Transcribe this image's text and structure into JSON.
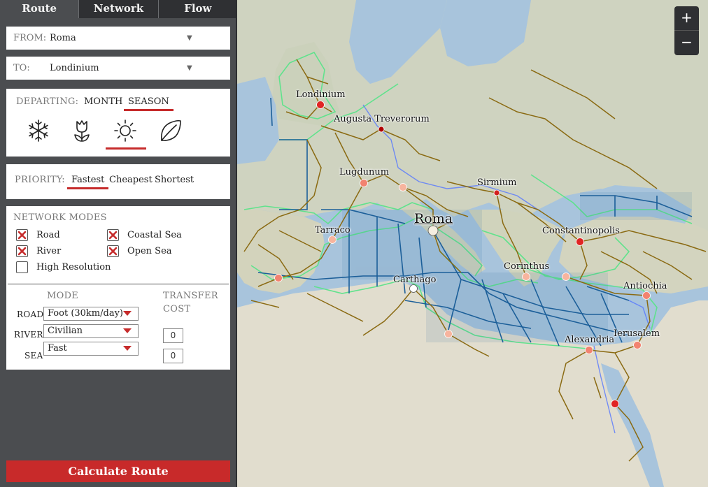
{
  "tabs": [
    "Route",
    "Network",
    "Flow"
  ],
  "from": {
    "label": "FROM:",
    "value": "Roma"
  },
  "to": {
    "label": "TO:",
    "value": "Londinium"
  },
  "departing": {
    "label": "DEPARTING:",
    "options": [
      "MONTH",
      "SEASON"
    ],
    "active": "SEASON",
    "seasons": [
      "winter-snowflake-icon",
      "spring-tulip-icon",
      "summer-sun-icon",
      "autumn-leaf-icon"
    ],
    "active_season": "summer"
  },
  "priority": {
    "label": "PRIORITY:",
    "options": [
      "Fastest",
      "Cheapest",
      "Shortest"
    ],
    "active": "Fastest"
  },
  "network_modes": {
    "title": "NETWORK MODES",
    "items": [
      {
        "label": "Road",
        "checked": true
      },
      {
        "label": "Coastal Sea",
        "checked": true
      },
      {
        "label": "River",
        "checked": true
      },
      {
        "label": "Open Sea",
        "checked": true
      },
      {
        "label": "High Resolution",
        "checked": false
      }
    ]
  },
  "modes": {
    "mode_header": "MODE",
    "transfer_header": "TRANSFER",
    "cost_header": "COST",
    "rows": [
      {
        "label": "ROAD",
        "value": "Foot (30km/day)"
      },
      {
        "label": "RIVER",
        "value": "Civilian"
      },
      {
        "label": "SEA",
        "value": "Fast"
      }
    ],
    "costs": [
      "0",
      "0"
    ]
  },
  "calculate_label": "Calculate Route",
  "zoom": {
    "in": "+",
    "out": "−"
  },
  "cities": [
    "Londinium",
    "Augusta Treverorum",
    "Lugdunum",
    "Sirmium",
    "Roma",
    "Tarraco",
    "Constantinopolis",
    "Corinthus",
    "Carthago",
    "Antiochia",
    "Alexandria",
    "Ierusalem"
  ],
  "colors": {
    "accent": "#c62b2b",
    "sea": "#a8c4dc",
    "road": "#8a6a12",
    "sea_route": "#1c5f99",
    "coastal": "#55e08a",
    "land": "#d9dccb"
  }
}
